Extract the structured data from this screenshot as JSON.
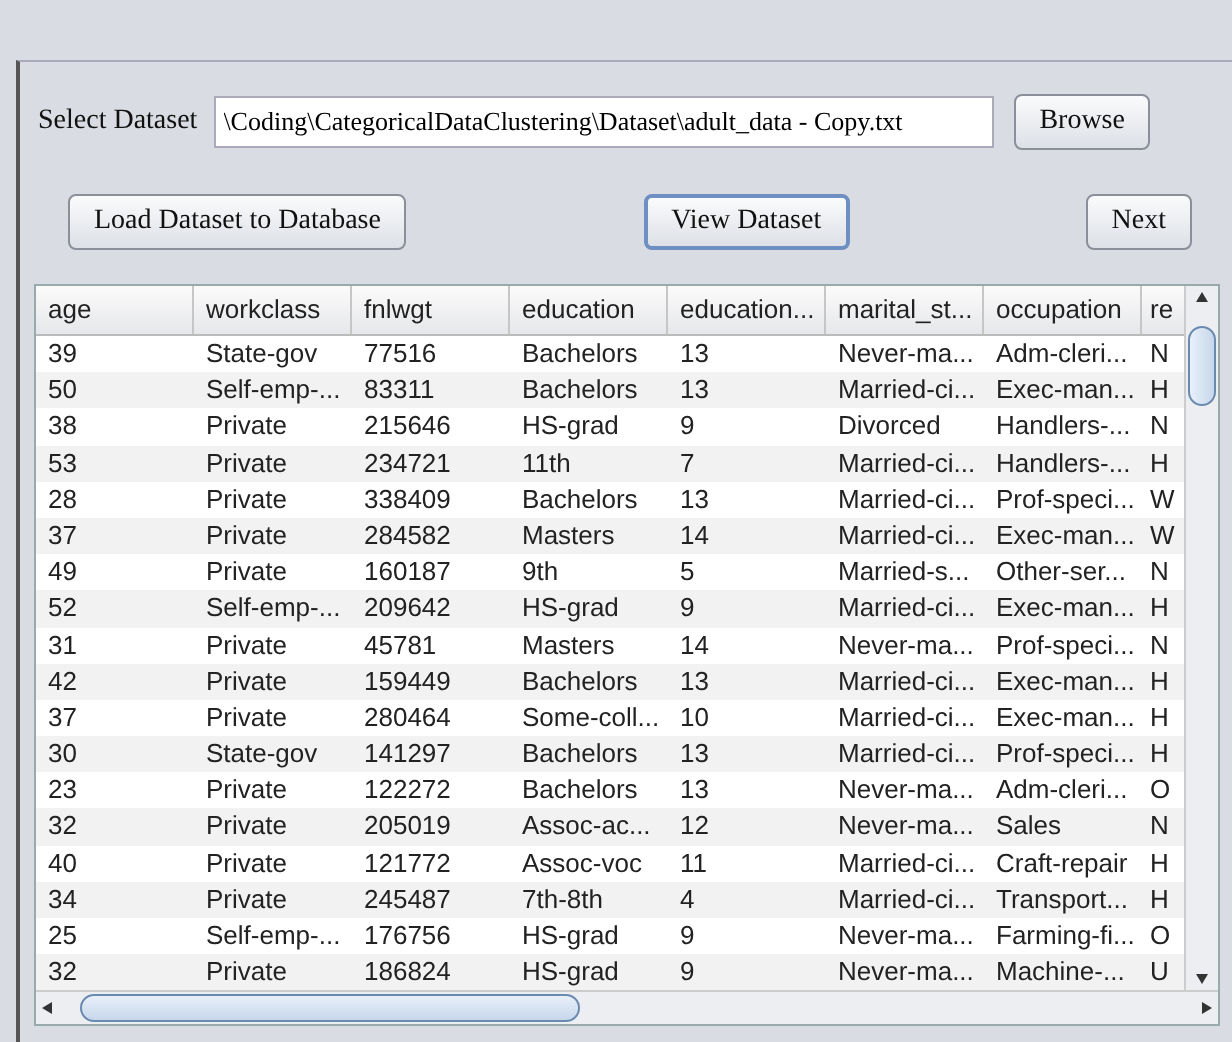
{
  "dataset": {
    "label": "Select Dataset",
    "path": "\\Coding\\CategoricalDataClustering\\Dataset\\adult_data - Copy.txt",
    "browse": "Browse"
  },
  "actions": [
    {
      "label": "Load Dataset to Database",
      "focused": false
    },
    {
      "label": "View Dataset",
      "focused": true
    },
    {
      "label": "Next",
      "focused": false
    }
  ],
  "table": {
    "columns": [
      "age",
      "workclass",
      "fnlwgt",
      "education",
      "education...",
      "marital_st...",
      "occupation",
      "re"
    ],
    "rows": [
      [
        "39",
        "State-gov",
        "77516",
        "Bachelors",
        "13",
        "Never-ma...",
        "Adm-cleri...",
        "N"
      ],
      [
        "50",
        "Self-emp-...",
        "83311",
        "Bachelors",
        "13",
        "Married-ci...",
        "Exec-man...",
        "H"
      ],
      [
        "38",
        "Private",
        "215646",
        "HS-grad",
        "9",
        "Divorced",
        "Handlers-...",
        "N"
      ],
      [
        "53",
        "Private",
        "234721",
        "11th",
        "7",
        "Married-ci...",
        "Handlers-...",
        "H"
      ],
      [
        "28",
        "Private",
        "338409",
        "Bachelors",
        "13",
        "Married-ci...",
        "Prof-speci...",
        "W"
      ],
      [
        "37",
        "Private",
        "284582",
        "Masters",
        "14",
        "Married-ci...",
        "Exec-man...",
        "W"
      ],
      [
        "49",
        "Private",
        "160187",
        "9th",
        "5",
        "Married-s...",
        "Other-ser...",
        "N"
      ],
      [
        "52",
        "Self-emp-...",
        "209642",
        "HS-grad",
        "9",
        "Married-ci...",
        "Exec-man...",
        "H"
      ],
      [
        "31",
        "Private",
        "45781",
        "Masters",
        "14",
        "Never-ma...",
        "Prof-speci...",
        "N"
      ],
      [
        "42",
        "Private",
        "159449",
        "Bachelors",
        "13",
        "Married-ci...",
        "Exec-man...",
        "H"
      ],
      [
        "37",
        "Private",
        "280464",
        "Some-coll...",
        "10",
        "Married-ci...",
        "Exec-man...",
        "H"
      ],
      [
        "30",
        "State-gov",
        "141297",
        "Bachelors",
        "13",
        "Married-ci...",
        "Prof-speci...",
        "H"
      ],
      [
        "23",
        "Private",
        "122272",
        "Bachelors",
        "13",
        "Never-ma...",
        "Adm-cleri...",
        "O"
      ],
      [
        "32",
        "Private",
        "205019",
        "Assoc-ac...",
        "12",
        "Never-ma...",
        "Sales",
        "N"
      ],
      [
        "40",
        "Private",
        "121772",
        "Assoc-voc",
        "11",
        "Married-ci...",
        "Craft-repair",
        "H"
      ],
      [
        "34",
        "Private",
        "245487",
        "7th-8th",
        "4",
        "Married-ci...",
        "Transport...",
        "H"
      ],
      [
        "25",
        "Self-emp-...",
        "176756",
        "HS-grad",
        "9",
        "Never-ma...",
        "Farming-fi...",
        "O"
      ],
      [
        "32",
        "Private",
        "186824",
        "HS-grad",
        "9",
        "Never-ma...",
        "Machine-...",
        "U"
      ]
    ]
  }
}
